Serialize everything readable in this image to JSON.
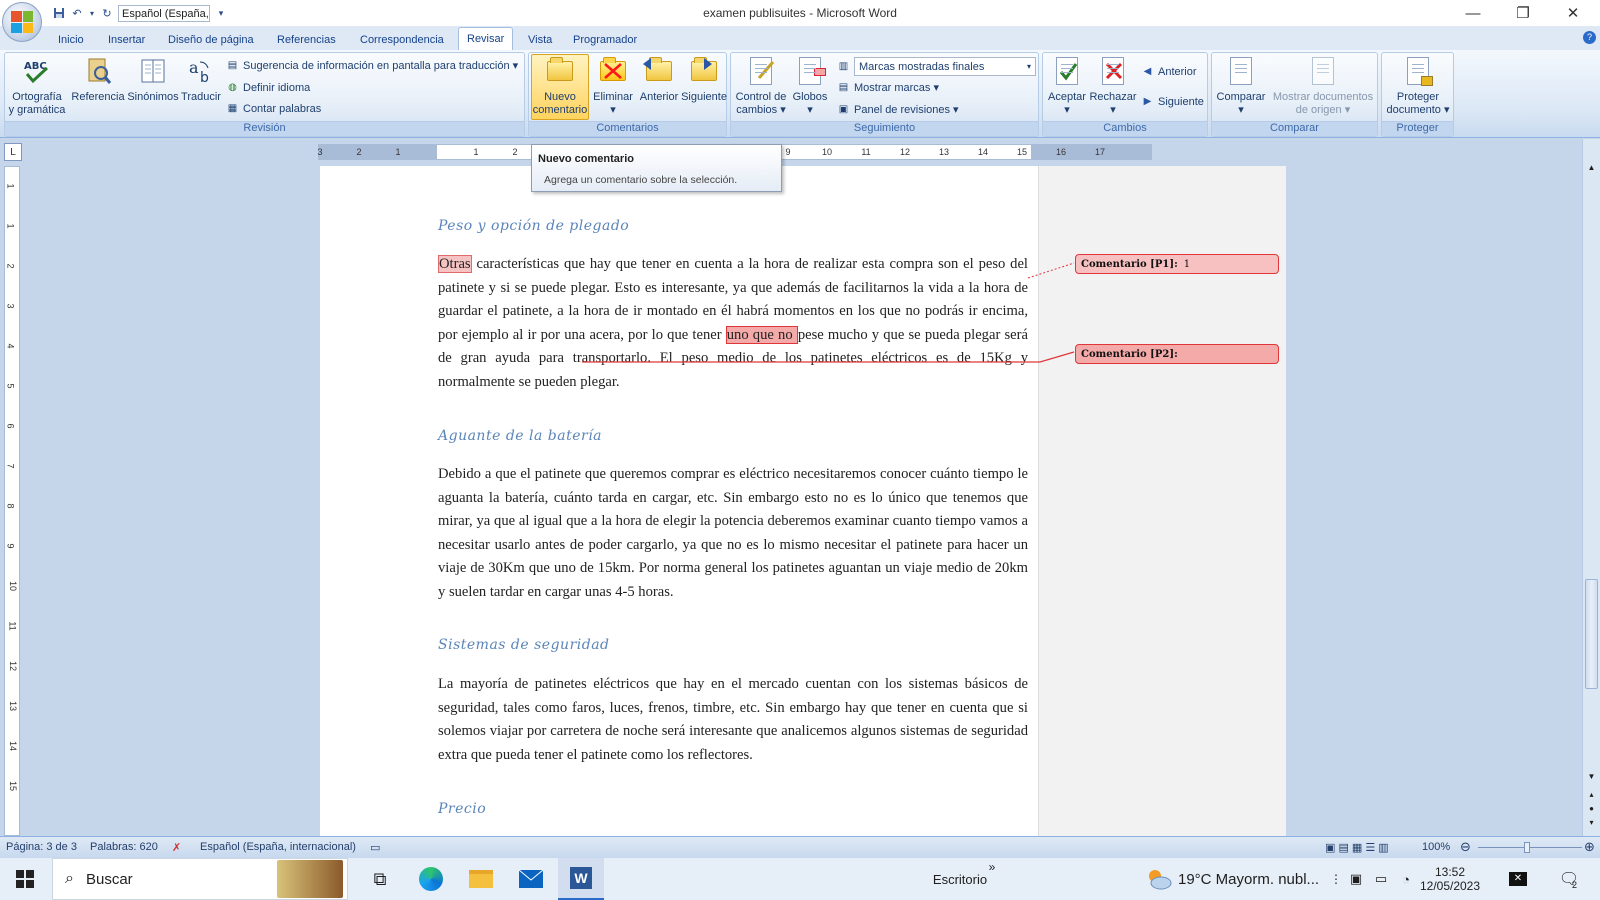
{
  "window": {
    "title": "examen publisuites - Microsoft Word",
    "minimize": "—",
    "restore": "❐",
    "close": "✕"
  },
  "qat": {
    "language": "Español (España, ▾",
    "customize": "▾"
  },
  "tabs": [
    "Inicio",
    "Insertar",
    "Diseño de página",
    "Referencias",
    "Correspondencia",
    "Revisar",
    "Vista",
    "Programador"
  ],
  "active_tab": "Revisar",
  "ribbon": {
    "revision": {
      "label": "Revisión",
      "spelling": "Ortografía\ny gramática",
      "research": "Referencia",
      "thesaurus": "Sinónimos",
      "translate": "Traducir",
      "translate_tip": "Sugerencia de información en pantalla para traducción ▾",
      "set_language": "Definir idioma",
      "word_count": "Contar palabras"
    },
    "comments": {
      "label": "Comentarios",
      "new": "Nuevo\ncomentario",
      "delete": "Eliminar\n▾",
      "previous": "Anterior",
      "next": "Siguiente"
    },
    "tracking": {
      "label": "Seguimiento",
      "track_changes": "Control de\ncambios ▾",
      "balloons": "Globos\n▾",
      "display_select": "Marcas mostradas finales",
      "show_markup": "Mostrar marcas ▾",
      "review_pane": "Panel de revisiones ▾"
    },
    "changes": {
      "label": "Cambios",
      "accept": "Aceptar\n▾",
      "reject": "Rechazar\n▾",
      "previous": "Anterior",
      "next": "Siguiente"
    },
    "compare": {
      "label": "Comparar",
      "compare": "Comparar\n▾",
      "show_source": "Mostrar documentos\nde origen ▾"
    },
    "protect": {
      "label": "Proteger",
      "protect_doc": "Proteger\ndocumento ▾"
    }
  },
  "tooltip": {
    "title": "Nuevo comentario",
    "text": "Agrega un comentario sobre la selección."
  },
  "ruler": {
    "ticks": [
      "3",
      "2",
      "1",
      "1",
      "2",
      "3",
      "4",
      "5",
      "6",
      "7",
      "8",
      "9",
      "10",
      "11",
      "12",
      "13",
      "14",
      "15",
      "16",
      "17"
    ],
    "vticks": [
      "1",
      "1",
      "2",
      "3",
      "4",
      "5",
      "6",
      "7",
      "8",
      "9",
      "10",
      "11",
      "12",
      "13",
      "14",
      "15"
    ]
  },
  "document": {
    "h1": "Peso y opción de plegado",
    "p1": {
      "hl1": "Otras",
      "a": " características que hay que tener en cuenta a la hora de realizar esta compra son el peso del patinete y si se puede plegar. Esto es interesante, ya que además de facilitarnos la vida a la hora de guardar el patinete, a la hora de ir montado en él  habrá momentos en los que no podrás ir encima, por ejemplo al ir por una acera, por lo que tener ",
      "hl2": "uno que no ",
      "b": "pese mucho y que se pueda plegar será de gran ayuda para transportarlo. El peso medio de los patinetes eléctricos es de 15Kg y normalmente se pueden plegar."
    },
    "h2": "Aguante de la batería",
    "p2": "Debido a que el patinete que queremos comprar es eléctrico necesitaremos conocer cuánto tiempo le aguanta la batería, cuánto tarda en cargar, etc. Sin embargo esto no es lo único que tenemos que mirar, ya que al igual que a la hora de elegir la potencia deberemos examinar cuanto tiempo vamos a necesitar usarlo antes de poder cargarlo, ya que no es lo mismo necesitar el patinete para hacer un viaje de 30Km que uno de 15km. Por norma general los patinetes aguantan un viaje medio de 20km y suelen tardar en cargar unas 4-5 horas.",
    "h3": "Sistemas de seguridad",
    "p3": "La mayoría de patinetes eléctricos que hay en el mercado cuentan con los sistemas básicos de seguridad, tales como faros, luces, frenos, timbre, etc. Sin embargo hay que tener en cuenta que si solemos viajar por carretera de noche será interesante que analicemos algunos sistemas de seguridad extra que pueda tener el patinete como los reflectores.",
    "h4": "Precio"
  },
  "comments": [
    {
      "label": "Comentario [P1]:",
      "text": "1"
    },
    {
      "label": "Comentario [P2]:",
      "text": ""
    }
  ],
  "status": {
    "page": "Página: 3 de 3",
    "words": "Palabras: 620",
    "language": "Español (España, internacional)",
    "zoom": "100%"
  },
  "taskbar": {
    "search": "Buscar",
    "desktop": "Escritorio",
    "weather": "19°C  Mayorm. nubl...",
    "time": "13:52",
    "date": "12/05/2023",
    "notifications": "2"
  },
  "colors": {
    "accent": "#15428b",
    "comment_fill": "#f7c1c1",
    "comment_border": "#e0363a",
    "heading": "#5b85b9"
  }
}
